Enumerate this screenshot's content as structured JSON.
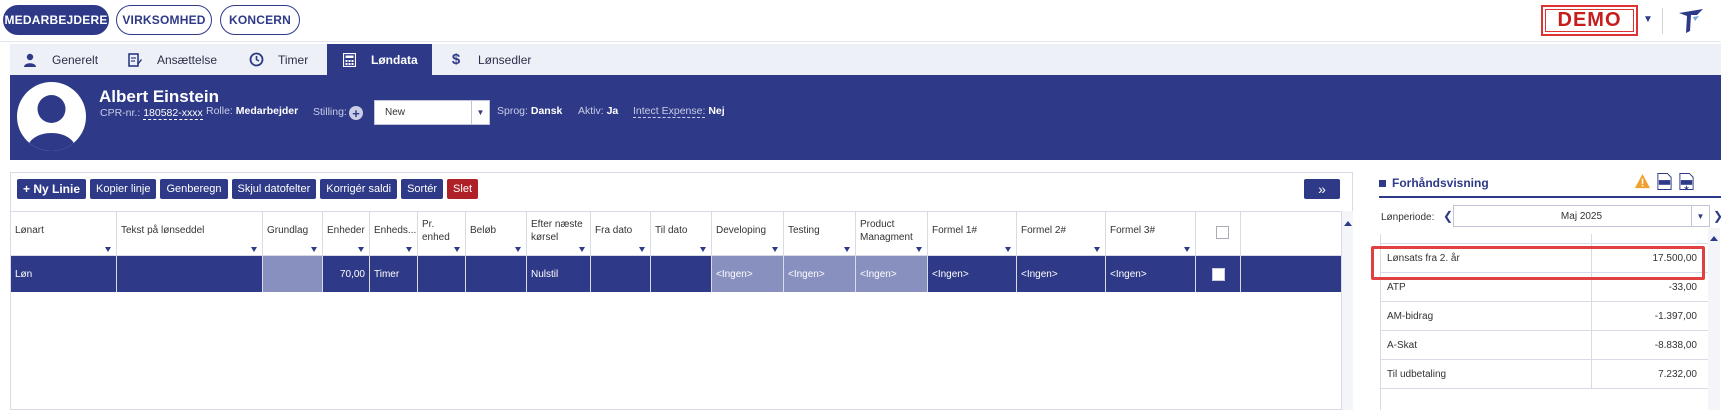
{
  "topnav": {
    "tabs": [
      "MEDARBEJDERE",
      "VIRKSOMHED",
      "KONCERN"
    ],
    "demo_label": "DEMO"
  },
  "tabs": [
    {
      "label": "Generelt",
      "icon": "user-icon"
    },
    {
      "label": "Ansættelse",
      "icon": "contract-edit-icon"
    },
    {
      "label": "Timer",
      "icon": "clock-icon"
    },
    {
      "label": "Løndata",
      "icon": "calculator-icon"
    },
    {
      "label": "Lønsedler",
      "icon": "dollar-icon"
    }
  ],
  "employee": {
    "name": "Albert Einstein",
    "cpr_label": "CPR-nr.:",
    "cpr_value": "180582-xxxx",
    "role_label": "Rolle:",
    "role_value": "Medarbejder",
    "stilling_label": "Stilling:",
    "stilling_value": "New",
    "sprog_label": "Sprog:",
    "sprog_value": "Dansk",
    "aktiv_label": "Aktiv:",
    "aktiv_value": "Ja",
    "expense_label": "Intect Expense:",
    "expense_value": "Nej"
  },
  "toolbar": {
    "new_line": "+ Ny Linie",
    "copy_line": "Kopier linje",
    "recalc": "Genberegn",
    "hide_date": "Skjul datofelter",
    "correct": "Korrigér saldi",
    "sort": "Sortér",
    "delete": "Slet",
    "expand": "»"
  },
  "grid": {
    "headers": [
      "Lønart",
      "Tekst på lønseddel",
      "Grundlag",
      "Enheder",
      "Enheds...",
      "Pr. enhed",
      "Beløb",
      "Efter næste kørsel",
      "Fra dato",
      "Til dato",
      "Developing",
      "Testing",
      "Product Managment",
      "Formel 1#",
      "Formel 2#",
      "Formel 3#"
    ],
    "rows": [
      [
        "Løn",
        "",
        "",
        "70,00",
        "Timer",
        "",
        "",
        "Nulstil",
        "",
        "",
        "<Ingen>",
        "<Ingen>",
        "<Ingen>",
        "<Ingen>",
        "<Ingen>",
        "<Ingen>"
      ]
    ]
  },
  "preview": {
    "title": "Forhåndsvisning",
    "period_label": "Lønperiode:",
    "period_value": "Maj 2025",
    "rows": [
      {
        "label": "Lønsats fra 2. år",
        "value": "17.500,00"
      },
      {
        "label": "ATP",
        "value": "-33,00"
      },
      {
        "label": "AM-bidrag",
        "value": "-1.397,00"
      },
      {
        "label": "A-Skat",
        "value": "-8.838,00"
      },
      {
        "label": "Til udbetaling",
        "value": "7.232,00"
      }
    ]
  },
  "colors": {
    "primary": "#2e3a87",
    "demo_red": "#c61d1d",
    "delete_red": "#b02027",
    "highlight_red": "#e04040"
  }
}
